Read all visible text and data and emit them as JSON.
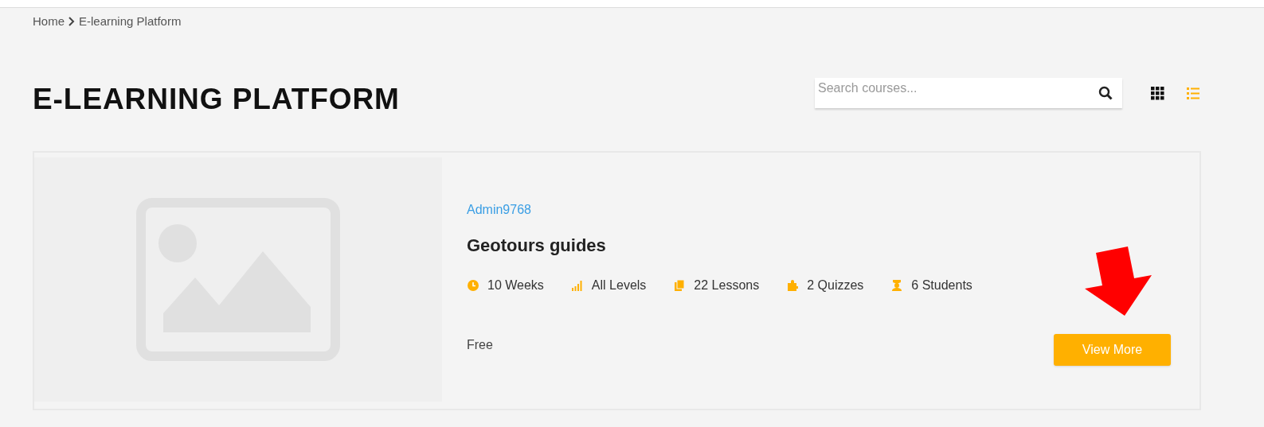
{
  "breadcrumb": [
    {
      "label": "Home"
    },
    {
      "label": "E-learning Platform"
    }
  ],
  "page_title": "E-LEARNING PLATFORM",
  "search": {
    "placeholder": "Search courses..."
  },
  "view_toggles": [
    {
      "kind": "grid",
      "selected": false
    },
    {
      "kind": "list",
      "selected": true
    }
  ],
  "course": {
    "author": "Admin9768",
    "title": "Geotours guides",
    "meta": [
      {
        "kind": "duration",
        "text": "10 Weeks"
      },
      {
        "kind": "level",
        "text": "All Levels"
      },
      {
        "kind": "lessons",
        "text": "22 Lessons"
      },
      {
        "kind": "quizzes",
        "text": "2 Quizzes"
      },
      {
        "kind": "students",
        "text": "6 Students"
      }
    ],
    "price": "Free",
    "button": "View More",
    "pointer_arrow": true
  }
}
